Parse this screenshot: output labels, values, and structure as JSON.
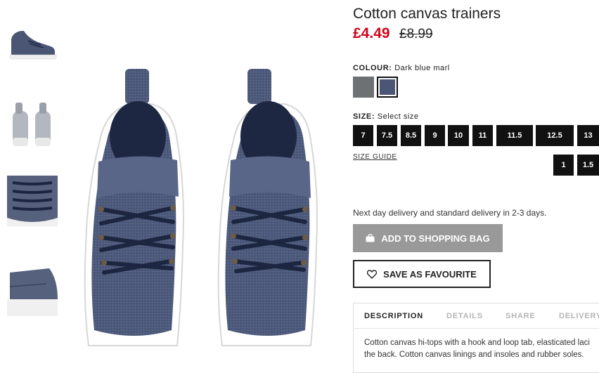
{
  "product": {
    "title": "Cotton canvas trainers",
    "price_now": "£4.49",
    "price_old": "£8.99"
  },
  "colour": {
    "label": "COLOUR:",
    "value": "Dark blue marl",
    "swatches": [
      {
        "name": "grey",
        "color": "#6e7173",
        "selected": false
      },
      {
        "name": "dark blue marl",
        "color": "#4a5674",
        "selected": true
      }
    ]
  },
  "size": {
    "label": "SIZE:",
    "value": "Select size",
    "options": [
      "7",
      "7.5",
      "8.5",
      "9",
      "10",
      "11",
      "11.5",
      "12.5",
      "13",
      "1",
      "1.5"
    ],
    "guide_label": "SIZE GUIDE"
  },
  "delivery_text": "Next day delivery and standard delivery in 2-3 days.",
  "buttons": {
    "add_to_bag": "ADD TO SHOPPING BAG",
    "save_favourite": "SAVE AS FAVOURITE",
    "bag_icon": "shopping-bag-icon",
    "heart_icon": "heart-icon"
  },
  "tabs": [
    {
      "label": "DESCRIPTION",
      "active": true
    },
    {
      "label": "DETAILS",
      "active": false
    },
    {
      "label": "SHARE",
      "active": false
    },
    {
      "label": "DELIVERY",
      "active": false
    }
  ],
  "description": "Cotton canvas hi-tops with a hook and loop tab, elasticated laci the back. Cotton canvas linings and insoles and rubber soles.",
  "colors": {
    "price_sale": "#d0021b",
    "button_grey": "#999999",
    "size_button": "#111111",
    "canvas_blue": "#4a5674"
  }
}
